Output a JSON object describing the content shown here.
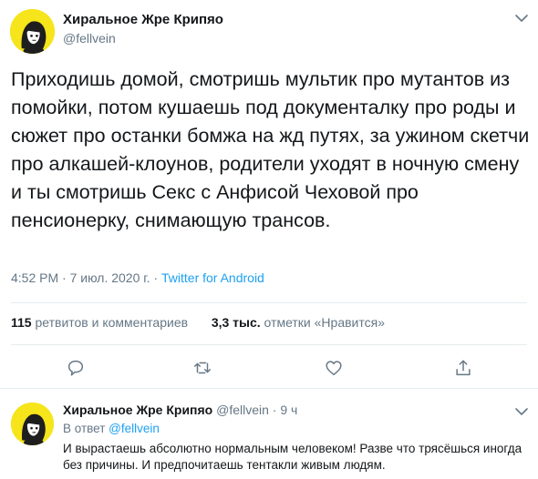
{
  "tweet": {
    "author_name": "Хиральное Жре Крипяо",
    "author_handle": "@fellvein",
    "text": "Приходишь домой, смотришь мультик про мутантов из помойки, потом кушаешь под документалку про роды и сюжет про останки бомжа на жд путях, за ужином скетчи про алкашей-клоунов, родители уходят в ночную смену и ты смотришь Секс с Анфисой Чеховой про пенсионерку, снимающую трансов.",
    "time": "4:52 PM",
    "separator": " · ",
    "date": "7 июл. 2020 г.",
    "source": "Twitter for Android",
    "retweets_count": "115",
    "retweets_label": " ретвитов и комментариев",
    "likes_count": "3,3 тыс.",
    "likes_label": " отметки «Нравится»"
  },
  "actions": [
    {
      "name": "reply",
      "icon": "comment-icon"
    },
    {
      "name": "retweet",
      "icon": "retweet-icon"
    },
    {
      "name": "like",
      "icon": "heart-icon"
    },
    {
      "name": "share",
      "icon": "share-icon"
    }
  ],
  "reply": {
    "author_name": "Хиральное Жре Крипяо",
    "author_handle": "@fellvein",
    "separator": " · ",
    "age": "9 ч",
    "in_reply_prefix": "В ответ ",
    "in_reply_to": "@fellvein",
    "text": "И вырастаешь абсолютно нормальным человеком! Разве что трясёшься иногда без причины. И предпочитаешь тентакли живым людям."
  },
  "colors": {
    "accent": "#1da1f2",
    "muted": "#657786",
    "text": "#14171a",
    "avatar_bg": "#f5e51a"
  }
}
